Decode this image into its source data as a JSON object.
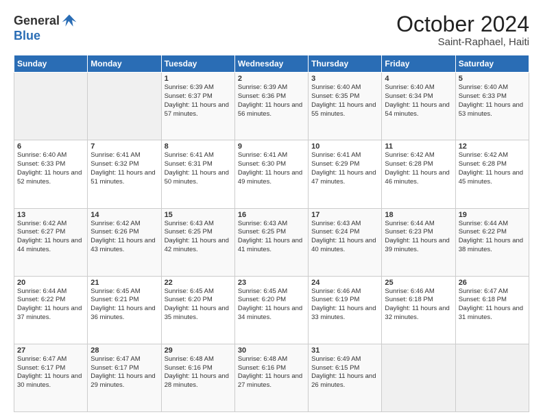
{
  "header": {
    "logo_general": "General",
    "logo_blue": "Blue",
    "month_title": "October 2024",
    "location": "Saint-Raphael, Haiti"
  },
  "weekdays": [
    "Sunday",
    "Monday",
    "Tuesday",
    "Wednesday",
    "Thursday",
    "Friday",
    "Saturday"
  ],
  "weeks": [
    [
      {
        "day": "",
        "info": ""
      },
      {
        "day": "",
        "info": ""
      },
      {
        "day": "1",
        "info": "Sunrise: 6:39 AM\nSunset: 6:37 PM\nDaylight: 11 hours and 57 minutes."
      },
      {
        "day": "2",
        "info": "Sunrise: 6:39 AM\nSunset: 6:36 PM\nDaylight: 11 hours and 56 minutes."
      },
      {
        "day": "3",
        "info": "Sunrise: 6:40 AM\nSunset: 6:35 PM\nDaylight: 11 hours and 55 minutes."
      },
      {
        "day": "4",
        "info": "Sunrise: 6:40 AM\nSunset: 6:34 PM\nDaylight: 11 hours and 54 minutes."
      },
      {
        "day": "5",
        "info": "Sunrise: 6:40 AM\nSunset: 6:33 PM\nDaylight: 11 hours and 53 minutes."
      }
    ],
    [
      {
        "day": "6",
        "info": "Sunrise: 6:40 AM\nSunset: 6:33 PM\nDaylight: 11 hours and 52 minutes."
      },
      {
        "day": "7",
        "info": "Sunrise: 6:41 AM\nSunset: 6:32 PM\nDaylight: 11 hours and 51 minutes."
      },
      {
        "day": "8",
        "info": "Sunrise: 6:41 AM\nSunset: 6:31 PM\nDaylight: 11 hours and 50 minutes."
      },
      {
        "day": "9",
        "info": "Sunrise: 6:41 AM\nSunset: 6:30 PM\nDaylight: 11 hours and 49 minutes."
      },
      {
        "day": "10",
        "info": "Sunrise: 6:41 AM\nSunset: 6:29 PM\nDaylight: 11 hours and 47 minutes."
      },
      {
        "day": "11",
        "info": "Sunrise: 6:42 AM\nSunset: 6:28 PM\nDaylight: 11 hours and 46 minutes."
      },
      {
        "day": "12",
        "info": "Sunrise: 6:42 AM\nSunset: 6:28 PM\nDaylight: 11 hours and 45 minutes."
      }
    ],
    [
      {
        "day": "13",
        "info": "Sunrise: 6:42 AM\nSunset: 6:27 PM\nDaylight: 11 hours and 44 minutes."
      },
      {
        "day": "14",
        "info": "Sunrise: 6:42 AM\nSunset: 6:26 PM\nDaylight: 11 hours and 43 minutes."
      },
      {
        "day": "15",
        "info": "Sunrise: 6:43 AM\nSunset: 6:25 PM\nDaylight: 11 hours and 42 minutes."
      },
      {
        "day": "16",
        "info": "Sunrise: 6:43 AM\nSunset: 6:25 PM\nDaylight: 11 hours and 41 minutes."
      },
      {
        "day": "17",
        "info": "Sunrise: 6:43 AM\nSunset: 6:24 PM\nDaylight: 11 hours and 40 minutes."
      },
      {
        "day": "18",
        "info": "Sunrise: 6:44 AM\nSunset: 6:23 PM\nDaylight: 11 hours and 39 minutes."
      },
      {
        "day": "19",
        "info": "Sunrise: 6:44 AM\nSunset: 6:22 PM\nDaylight: 11 hours and 38 minutes."
      }
    ],
    [
      {
        "day": "20",
        "info": "Sunrise: 6:44 AM\nSunset: 6:22 PM\nDaylight: 11 hours and 37 minutes."
      },
      {
        "day": "21",
        "info": "Sunrise: 6:45 AM\nSunset: 6:21 PM\nDaylight: 11 hours and 36 minutes."
      },
      {
        "day": "22",
        "info": "Sunrise: 6:45 AM\nSunset: 6:20 PM\nDaylight: 11 hours and 35 minutes."
      },
      {
        "day": "23",
        "info": "Sunrise: 6:45 AM\nSunset: 6:20 PM\nDaylight: 11 hours and 34 minutes."
      },
      {
        "day": "24",
        "info": "Sunrise: 6:46 AM\nSunset: 6:19 PM\nDaylight: 11 hours and 33 minutes."
      },
      {
        "day": "25",
        "info": "Sunrise: 6:46 AM\nSunset: 6:18 PM\nDaylight: 11 hours and 32 minutes."
      },
      {
        "day": "26",
        "info": "Sunrise: 6:47 AM\nSunset: 6:18 PM\nDaylight: 11 hours and 31 minutes."
      }
    ],
    [
      {
        "day": "27",
        "info": "Sunrise: 6:47 AM\nSunset: 6:17 PM\nDaylight: 11 hours and 30 minutes."
      },
      {
        "day": "28",
        "info": "Sunrise: 6:47 AM\nSunset: 6:17 PM\nDaylight: 11 hours and 29 minutes."
      },
      {
        "day": "29",
        "info": "Sunrise: 6:48 AM\nSunset: 6:16 PM\nDaylight: 11 hours and 28 minutes."
      },
      {
        "day": "30",
        "info": "Sunrise: 6:48 AM\nSunset: 6:16 PM\nDaylight: 11 hours and 27 minutes."
      },
      {
        "day": "31",
        "info": "Sunrise: 6:49 AM\nSunset: 6:15 PM\nDaylight: 11 hours and 26 minutes."
      },
      {
        "day": "",
        "info": ""
      },
      {
        "day": "",
        "info": ""
      }
    ]
  ]
}
